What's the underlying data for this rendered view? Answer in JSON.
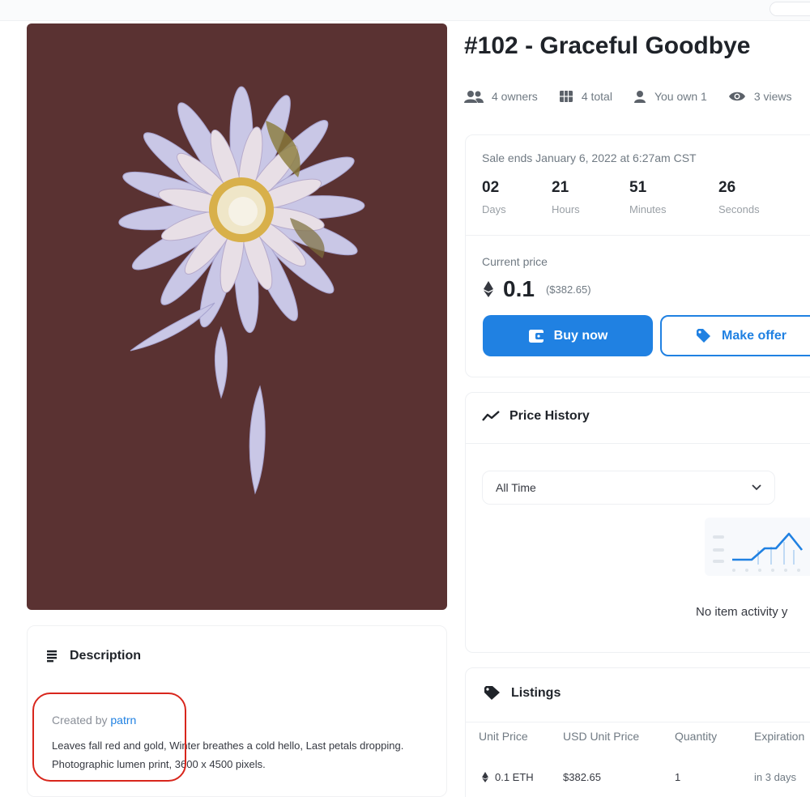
{
  "nft": {
    "title": "#102 - Graceful Goodbye"
  },
  "stats": {
    "owners": "4 owners",
    "total": "4 total",
    "you_own": "You own 1",
    "views": "3 views"
  },
  "sale": {
    "ends": "Sale ends January 6, 2022 at 6:27am CST",
    "countdown": [
      {
        "value": "02",
        "label": "Days"
      },
      {
        "value": "21",
        "label": "Hours"
      },
      {
        "value": "51",
        "label": "Minutes"
      },
      {
        "value": "26",
        "label": "Seconds"
      }
    ],
    "current_price_label": "Current price",
    "price": "0.1",
    "price_usd": "($382.65)",
    "buy_label": "Buy now",
    "offer_label": "Make offer"
  },
  "price_history": {
    "title": "Price History",
    "selected_range": "All Time",
    "empty_text": "No item activity y"
  },
  "listings": {
    "title": "Listings",
    "columns": [
      "Unit Price",
      "USD Unit Price",
      "Quantity",
      "Expiration"
    ],
    "rows": [
      {
        "unit_price": "0.1 ETH",
        "usd_price": "$382.65",
        "quantity": "1",
        "expiration": "in 3 days"
      }
    ]
  },
  "description": {
    "title": "Description",
    "created_by_prefix": "Created by",
    "creator": "patrn",
    "text": "Leaves fall red and gold, Winter breathes a cold hello, Last petals dropping. Photographic lumen print, 3600 x 4500 pixels."
  },
  "colors": {
    "accent": "#2081e2",
    "artwork_bg": "#5a3232",
    "highlight": "#d8261c"
  }
}
